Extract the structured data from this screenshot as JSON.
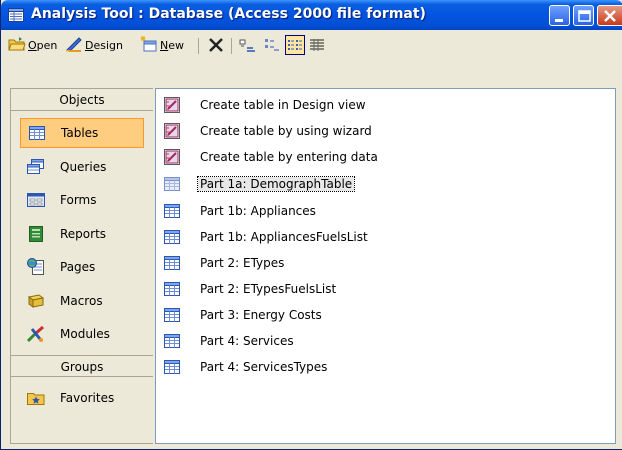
{
  "window": {
    "title": "Analysis Tool : Database (Access 2000 file format)"
  },
  "toolbar": {
    "open_label": "Open",
    "open_accel": "O",
    "design_label": "Design",
    "design_accel": "D",
    "new_label": "New",
    "new_accel": "N"
  },
  "sidebar": {
    "objects_header": "Objects",
    "groups_header": "Groups",
    "items": [
      {
        "label": "Tables",
        "icon": "table-icon",
        "selected": true
      },
      {
        "label": "Queries",
        "icon": "query-icon",
        "selected": false
      },
      {
        "label": "Forms",
        "icon": "form-icon",
        "selected": false
      },
      {
        "label": "Reports",
        "icon": "report-icon",
        "selected": false
      },
      {
        "label": "Pages",
        "icon": "page-icon",
        "selected": false
      },
      {
        "label": "Macros",
        "icon": "macro-icon",
        "selected": false
      },
      {
        "label": "Modules",
        "icon": "module-icon",
        "selected": false
      }
    ],
    "groups": [
      {
        "label": "Favorites",
        "icon": "favorites-folder-icon"
      }
    ]
  },
  "list": {
    "items": [
      {
        "label": "Create table in Design view",
        "icon": "create-shortcut-icon"
      },
      {
        "label": "Create table by using wizard",
        "icon": "create-shortcut-icon"
      },
      {
        "label": "Create table by entering data",
        "icon": "create-shortcut-icon"
      },
      {
        "label": "Part 1a: DemographTable",
        "icon": "table-icon",
        "focused": true
      },
      {
        "label": "Part 1b: Appliances",
        "icon": "table-icon"
      },
      {
        "label": "Part 1b: AppliancesFuelsList",
        "icon": "table-icon"
      },
      {
        "label": "Part 2: ETypes",
        "icon": "table-icon"
      },
      {
        "label": "Part 2: ETypesFuelsList",
        "icon": "table-icon"
      },
      {
        "label": "Part 3: Energy Costs",
        "icon": "table-icon"
      },
      {
        "label": "Part 4: Services",
        "icon": "table-icon"
      },
      {
        "label": "Part 4: ServicesTypes",
        "icon": "table-icon"
      }
    ]
  },
  "colors": {
    "titlebar": "#0454e0",
    "selected_bg": "#ffcd80",
    "selected_border": "#ff9a2a"
  }
}
